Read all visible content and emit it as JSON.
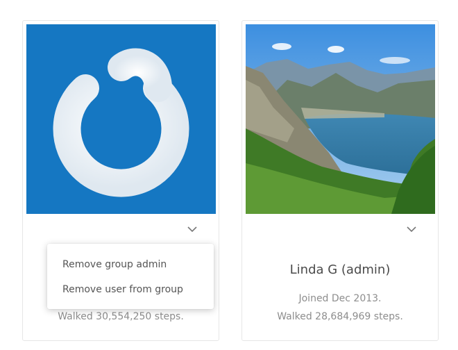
{
  "cards": [
    {
      "avatar_icon": "power-logo-icon",
      "walked": "Walked 30,554,250 steps."
    },
    {
      "name": "Linda G (admin)",
      "joined": "Joined Dec 2013.",
      "walked": "Walked 28,684,969 steps.",
      "avatar_icon": "lake-mountain-photo"
    }
  ],
  "menu": {
    "items": [
      {
        "label": "Remove group admin"
      },
      {
        "label": "Remove user from group"
      }
    ]
  },
  "colors": {
    "logo_bg": "#1577c2",
    "text": "#5d5d5d",
    "muted": "#8d8d8d"
  }
}
